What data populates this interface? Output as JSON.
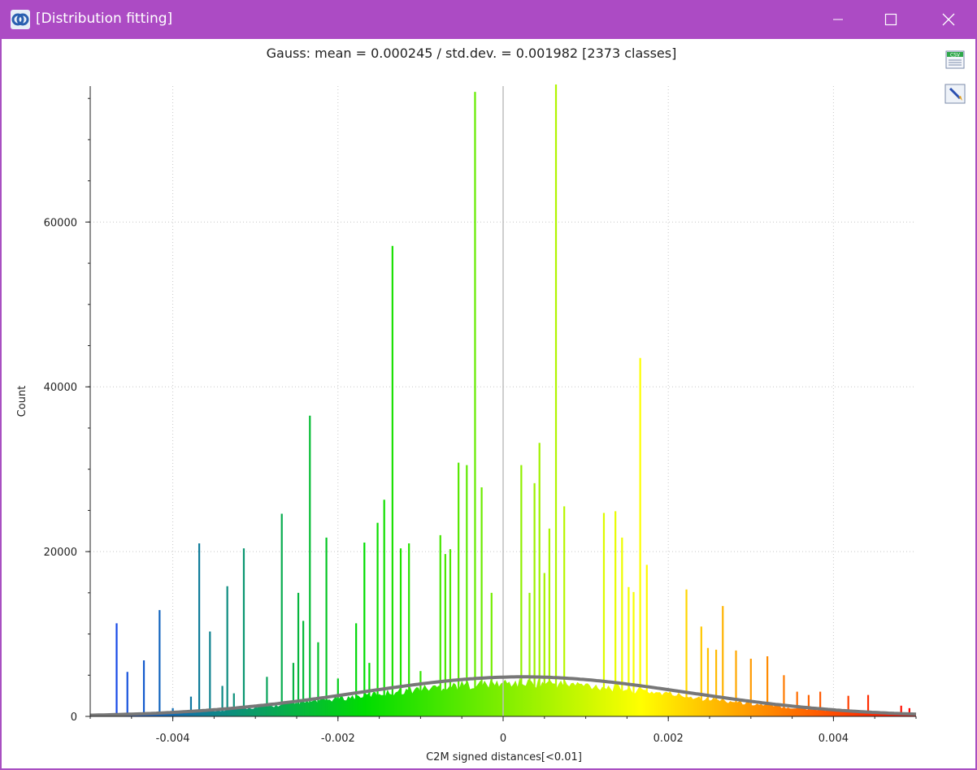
{
  "window": {
    "title": "[Distribution fitting]",
    "icon": "cloudcompare-icon",
    "controls": [
      "minimize-icon",
      "maximize-icon",
      "close-icon"
    ]
  },
  "toolbar": {
    "buttons": [
      "export-csv-icon",
      "export-image-icon"
    ],
    "csv_label": "CSV"
  },
  "chart_data": {
    "type": "bar",
    "title": "Gauss: mean = 0.000245 / std.dev. = 0.001982 [2373 classes]",
    "xlabel": "C2M signed distances[<0.01]",
    "ylabel": "Count",
    "xlim": [
      -0.005,
      0.005
    ],
    "ylim": [
      0,
      76500
    ],
    "xticks": [
      -0.004,
      -0.002,
      0,
      0.002,
      0.004
    ],
    "xtick_labels": [
      "-0.004",
      "-0.002",
      "0",
      "0.002",
      "0.004"
    ],
    "yticks": [
      0,
      20000,
      40000,
      60000
    ],
    "ytick_labels": [
      "0",
      "20000",
      "40000",
      "60000"
    ],
    "grid": true,
    "colormap": [
      "#1a3cff",
      "#00dd00",
      "#ffff00",
      "#ff0000"
    ],
    "marker_x": 0,
    "gaussian": {
      "mean": 0.000245,
      "std": 0.001982,
      "peak": 4800,
      "color": "#777777"
    },
    "spikes": [
      {
        "x": -0.00468,
        "y": 11300
      },
      {
        "x": -0.00455,
        "y": 5400
      },
      {
        "x": -0.00435,
        "y": 6800
      },
      {
        "x": -0.00416,
        "y": 12900
      },
      {
        "x": -0.004,
        "y": 1000
      },
      {
        "x": -0.00378,
        "y": 2400
      },
      {
        "x": -0.00368,
        "y": 21000
      },
      {
        "x": -0.00355,
        "y": 10300
      },
      {
        "x": -0.0034,
        "y": 3700
      },
      {
        "x": -0.00334,
        "y": 15800
      },
      {
        "x": -0.00326,
        "y": 2800
      },
      {
        "x": -0.00314,
        "y": 20400
      },
      {
        "x": -0.00286,
        "y": 4800
      },
      {
        "x": -0.00268,
        "y": 24600
      },
      {
        "x": -0.00254,
        "y": 6500
      },
      {
        "x": -0.00248,
        "y": 15000
      },
      {
        "x": -0.00242,
        "y": 11600
      },
      {
        "x": -0.00234,
        "y": 36500
      },
      {
        "x": -0.00224,
        "y": 9000
      },
      {
        "x": -0.00214,
        "y": 21700
      },
      {
        "x": -0.002,
        "y": 4600
      },
      {
        "x": -0.00178,
        "y": 11300
      },
      {
        "x": -0.00168,
        "y": 21100
      },
      {
        "x": -0.00162,
        "y": 6500
      },
      {
        "x": -0.00152,
        "y": 23500
      },
      {
        "x": -0.00144,
        "y": 26300
      },
      {
        "x": -0.00134,
        "y": 57100
      },
      {
        "x": -0.00124,
        "y": 20400
      },
      {
        "x": -0.00114,
        "y": 21000
      },
      {
        "x": -0.001,
        "y": 5500
      },
      {
        "x": -0.00076,
        "y": 22000
      },
      {
        "x": -0.0007,
        "y": 19700
      },
      {
        "x": -0.00064,
        "y": 20300
      },
      {
        "x": -0.00054,
        "y": 30800
      },
      {
        "x": -0.00044,
        "y": 30500
      },
      {
        "x": -0.00034,
        "y": 75800
      },
      {
        "x": -0.00026,
        "y": 27800
      },
      {
        "x": -0.00014,
        "y": 15000
      },
      {
        "x": 0.00022,
        "y": 30500
      },
      {
        "x": 0.00032,
        "y": 15000
      },
      {
        "x": 0.00038,
        "y": 28300
      },
      {
        "x": 0.00044,
        "y": 33200
      },
      {
        "x": 0.0005,
        "y": 17400
      },
      {
        "x": 0.00056,
        "y": 22800
      },
      {
        "x": 0.00064,
        "y": 76700
      },
      {
        "x": 0.00074,
        "y": 25500
      },
      {
        "x": 0.00122,
        "y": 24700
      },
      {
        "x": 0.00136,
        "y": 24900
      },
      {
        "x": 0.00144,
        "y": 21700
      },
      {
        "x": 0.00152,
        "y": 15700
      },
      {
        "x": 0.00158,
        "y": 15100
      },
      {
        "x": 0.00166,
        "y": 43500
      },
      {
        "x": 0.00174,
        "y": 18400
      },
      {
        "x": 0.00222,
        "y": 15400
      },
      {
        "x": 0.0024,
        "y": 10900
      },
      {
        "x": 0.00248,
        "y": 8300
      },
      {
        "x": 0.00258,
        "y": 8100
      },
      {
        "x": 0.00266,
        "y": 13400
      },
      {
        "x": 0.00282,
        "y": 8000
      },
      {
        "x": 0.003,
        "y": 7000
      },
      {
        "x": 0.0032,
        "y": 7300
      },
      {
        "x": 0.0034,
        "y": 5000
      },
      {
        "x": 0.00356,
        "y": 3000
      },
      {
        "x": 0.0037,
        "y": 2600
      },
      {
        "x": 0.00384,
        "y": 3000
      },
      {
        "x": 0.00418,
        "y": 2500
      },
      {
        "x": 0.00442,
        "y": 2600
      },
      {
        "x": 0.00482,
        "y": 1300
      },
      {
        "x": 0.00492,
        "y": 1000
      }
    ]
  }
}
